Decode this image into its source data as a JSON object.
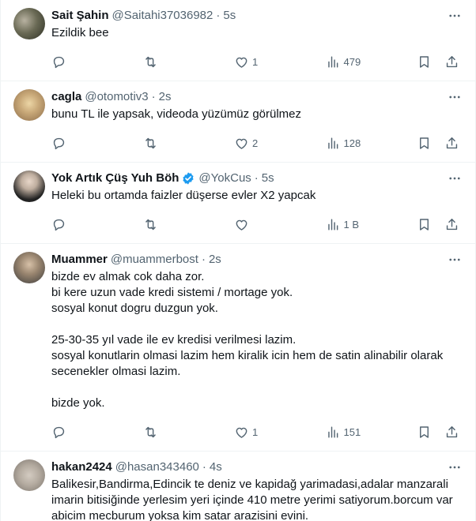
{
  "tweets": [
    {
      "name": "Sait Şahin",
      "handle": "@Saitahi37036982",
      "sep": "·",
      "time": "5s",
      "text": "Ezildik bee",
      "verified": false,
      "replies": "",
      "retweets": "",
      "likes": "1",
      "views": "479"
    },
    {
      "name": "cagla",
      "handle": "@otomotiv3",
      "sep": "·",
      "time": "2s",
      "text": "bunu TL ile yapsak, videoda yüzümüz görülmez",
      "verified": false,
      "replies": "",
      "retweets": "",
      "likes": "2",
      "views": "128"
    },
    {
      "name": "Yok Artık Çüş Yuh Böh",
      "handle": "@YokCus",
      "sep": "·",
      "time": "5s",
      "text": "Heleki bu ortamda faizler düşerse evler X2 yapcak",
      "verified": true,
      "replies": "",
      "retweets": "",
      "likes": "",
      "views": "1 B"
    },
    {
      "name": "Muammer",
      "handle": "@muammerbost",
      "sep": "·",
      "time": "2s",
      "text": "bizde ev almak cok daha zor.\nbi kere uzun vade kredi sistemi / mortage yok.\nsosyal konut dogru duzgun yok.\n\n25-30-35 yıl vade ile ev kredisi verilmesi lazim.\nsosyal konutlarin olmasi lazim hem kiralik icin hem de satin alinabilir olarak secenekler olmasi lazim.\n\nbizde yok.",
      "verified": false,
      "replies": "",
      "retweets": "",
      "likes": "1",
      "views": "151"
    },
    {
      "name": "hakan2424",
      "handle": "@hasan343460",
      "sep": "·",
      "time": "4s",
      "text": "Balikesir,Bandirma,Edincik te deniz ve kapidağ yarimadasi,adalar manzarali imarin bitisiğinde yerlesim yeri içinde 410 metre yerimi satiyorum.borcum var abicim mecburum yoksa kim satar arazisini evini.",
      "verified": false
    }
  ],
  "colors": {
    "text": "#0f1419",
    "secondary": "#536471",
    "verified": "#1d9bf0",
    "divider": "#eff3f4"
  },
  "icons": [
    "more-icon",
    "reply-icon",
    "retweet-icon",
    "like-icon",
    "views-icon",
    "bookmark-icon",
    "share-icon",
    "verified-badge-icon"
  ]
}
